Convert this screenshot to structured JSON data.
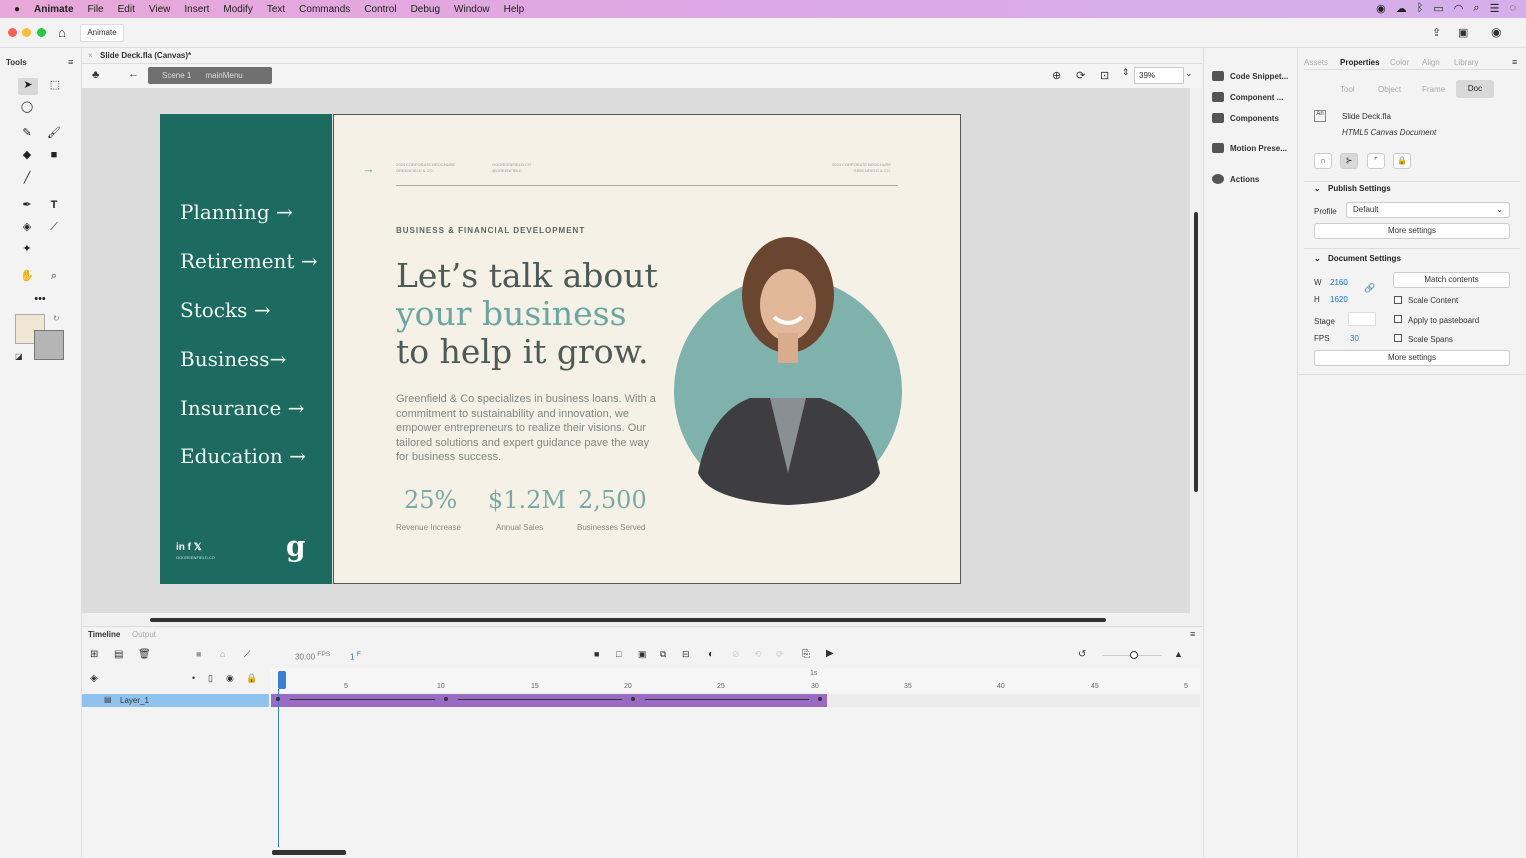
{
  "menu": {
    "apple": "",
    "app": "Animate",
    "items": [
      "File",
      "Edit",
      "View",
      "Insert",
      "Modify",
      "Text",
      "Commands",
      "Control",
      "Debug",
      "Window",
      "Help"
    ]
  },
  "appbar": {
    "workspace_label": "Animate"
  },
  "tools": {
    "title": "Tools"
  },
  "document": {
    "tab_title": "Slide Deck.fla (Canvas)*",
    "scene": "Scene 1",
    "symbol": "mainMenu",
    "zoom": "39%"
  },
  "slide": {
    "nav": [
      "Planning →",
      "Retirement →",
      "Stocks →",
      "Business→",
      "Insurance →",
      "Education →"
    ],
    "social": "in f 𝕏",
    "social_sub": "GOGREENFIELD.CO",
    "logo": "g",
    "header_left": "2024 CORPORATE BROCHURE\nGREENFIELD & CO.",
    "header_mid": "GOGREENFIELD.CO\n@GREENFIELD",
    "header_right": "2024 CORPORATE BROCHURE\nGREENFIELD & CO.",
    "eyebrow": "BUSINESS & FINANCIAL DEVELOPMENT",
    "headline_1": "Let’s talk about",
    "headline_2": "your business",
    "headline_3": "to help it grow.",
    "body": "Greenfield & Co specializes in business loans. With a commitment to sustainability and innovation, we empower entrepreneurs to realize their visions. Our tailored solutions and expert guidance pave the way for business success.",
    "stats": [
      {
        "value": "25%",
        "label": "Revenue Increase"
      },
      {
        "value": "$1.2M",
        "label": "Annual Sales"
      },
      {
        "value": "2,500",
        "label": "Businesses Served"
      }
    ]
  },
  "midpanel": {
    "items": [
      "Code Snippet...",
      "Component ...",
      "Components",
      "Motion Prese...",
      "Actions"
    ]
  },
  "properties": {
    "tabs": [
      "Assets",
      "Properties",
      "Color",
      "Align",
      "Library"
    ],
    "subtabs": [
      "Tool",
      "Object",
      "Frame",
      "Doc"
    ],
    "doc_name": "Slide Deck.fla",
    "doc_type": "HTML5 Canvas Document",
    "publish_settings": "Publish Settings",
    "profile_label": "Profile",
    "profile_value": "Default",
    "more_settings": "More settings",
    "document_settings": "Document Settings",
    "w_label": "W",
    "w_value": "2160",
    "h_label": "H",
    "h_value": "1620",
    "match_contents": "Match contents",
    "scale_content": "Scale Content",
    "stage_label": "Stage",
    "apply_pasteboard": "Apply to pasteboard",
    "fps_label": "FPS",
    "fps_value": "30",
    "scale_spans": "Scale Spans",
    "more_settings_2": "More settings"
  },
  "timeline": {
    "tab_timeline": "Timeline",
    "tab_output": "Output",
    "fps": "30.00",
    "fps_unit": "FPS",
    "frame": "1",
    "frame_unit": "F",
    "second_marker": "1s",
    "ticks": [
      "5",
      "10",
      "15",
      "20",
      "25",
      "30",
      "35",
      "40",
      "45",
      "5"
    ],
    "layer": "Layer_1"
  },
  "colors": {
    "accent": "#1d6b60",
    "tween": "#9a6bc2",
    "layer_sel": "#8fc3ee",
    "playhead": "#3a7fd5"
  }
}
